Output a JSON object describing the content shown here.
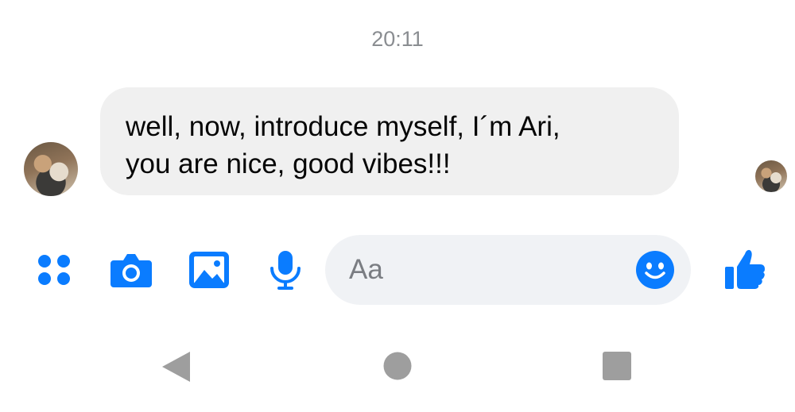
{
  "chat": {
    "timestamp": "20:11",
    "messages": [
      {
        "sender": "other",
        "lines": [
          "well, now, introduce myself, I´m Ari,",
          "you are nice, good vibes!!!"
        ]
      }
    ]
  },
  "composer": {
    "placeholder": "Aa",
    "icons": [
      "apps-icon",
      "camera-icon",
      "gallery-icon",
      "microphone-icon",
      "emoji-icon",
      "thumbs-up-icon"
    ],
    "accent_color": "#0a7cff"
  },
  "navbar": {
    "buttons": [
      "back-icon",
      "home-icon",
      "recents-icon"
    ]
  }
}
